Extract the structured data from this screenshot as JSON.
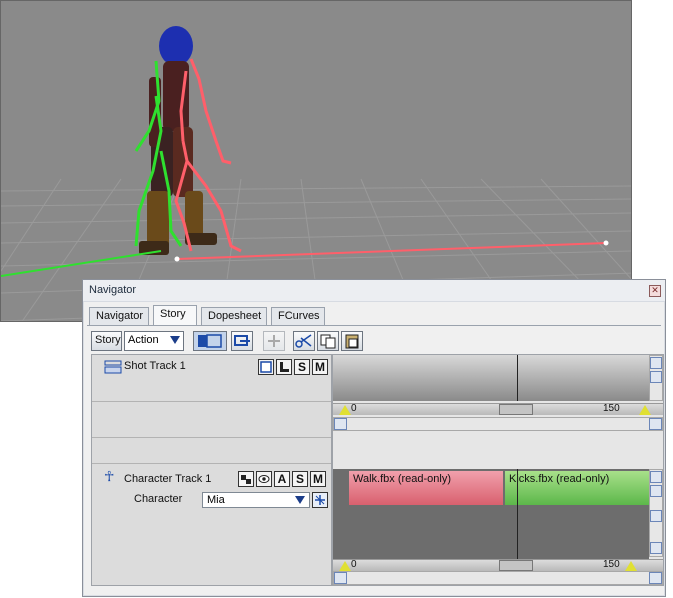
{
  "window": {
    "title": "Navigator"
  },
  "tabs": [
    {
      "label": "Navigator",
      "active": false
    },
    {
      "label": "Story",
      "active": true
    },
    {
      "label": "Dopesheet",
      "active": false
    },
    {
      "label": "FCurves",
      "active": false
    }
  ],
  "toolbar": {
    "story_label": "Story",
    "action_value": "Action",
    "icons": [
      "timeline-icon",
      "loop-icon",
      "insert-icon",
      "cut-icon",
      "copy-icon",
      "paste-icon"
    ]
  },
  "shot_track": {
    "name": "Shot Track 1",
    "buttons": [
      "",
      "",
      "S",
      "M"
    ],
    "ruler": {
      "start": "0",
      "mark": "150"
    }
  },
  "character_track": {
    "name": "Character Track 1",
    "buttons": [
      "",
      "",
      "A",
      "S",
      "M"
    ],
    "character_label": "Character",
    "character_value": "Mia",
    "clips": [
      {
        "label": "Walk.fbx (read-only)",
        "color": "#e47e8a"
      },
      {
        "label": "Kicks.fbx (read-only)",
        "color": "#86cf72"
      }
    ],
    "ruler": {
      "start": "0",
      "mark": "150"
    }
  },
  "colors": {
    "viewport_bg": "#8a8a8a",
    "skeleton_red": "#ff5f6a",
    "skeleton_green": "#2fe02f",
    "hair_blue": "#1d2fb0"
  }
}
